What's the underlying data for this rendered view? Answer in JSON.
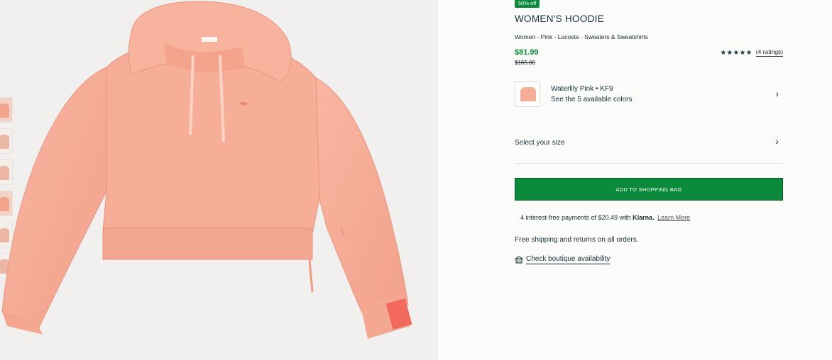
{
  "gallery": {
    "thumbnail_count": 6
  },
  "product": {
    "discount_badge": "50% off",
    "title": "WOMEN'S HOODIE",
    "breadcrumb": "Women - Pink - Lacoste - Sweaters & Sweatshirts",
    "price": "$81.99",
    "original_price": "$165.00",
    "stars": "★★★★★",
    "ratings_link": "(4 ratings)",
    "accent_color": "#0a8a3a",
    "garment_color": "#f4a994"
  },
  "color_selector": {
    "color_name": "Waterlily Pink • KF9",
    "available_colors": "See the 5 available colors"
  },
  "size_selector": {
    "label": "Select your size"
  },
  "actions": {
    "add_to_bag": "ADD TO SHOPPING BAG"
  },
  "klarna": {
    "prefix": "4 interest-free payments of $20.49 with",
    "brand": "Klarna.",
    "learn_more": "Learn More"
  },
  "info": {
    "shipping": "Free shipping and returns on all orders.",
    "boutique": "Check boutique availability"
  },
  "icons": {
    "chevron": "chevron-right-icon",
    "store": "store-icon",
    "star": "star-icon"
  }
}
